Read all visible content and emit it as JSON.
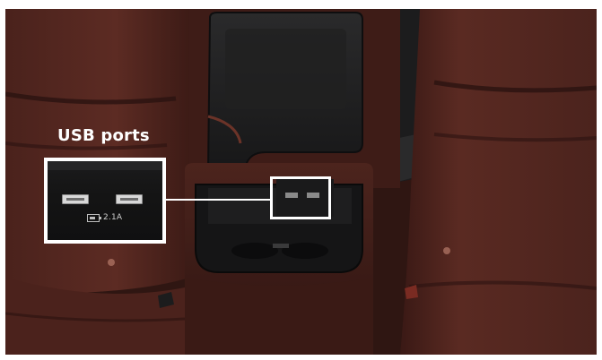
{
  "callout": {
    "label": "USB ports",
    "inset": {
      "rating_text": "2.1A",
      "rating_icon": "battery-icon",
      "port_icon": "usb-port-icon"
    }
  },
  "colors": {
    "leather": "#5a2a22",
    "armrest": "#1a1a1b",
    "callout": "#ffffff"
  }
}
